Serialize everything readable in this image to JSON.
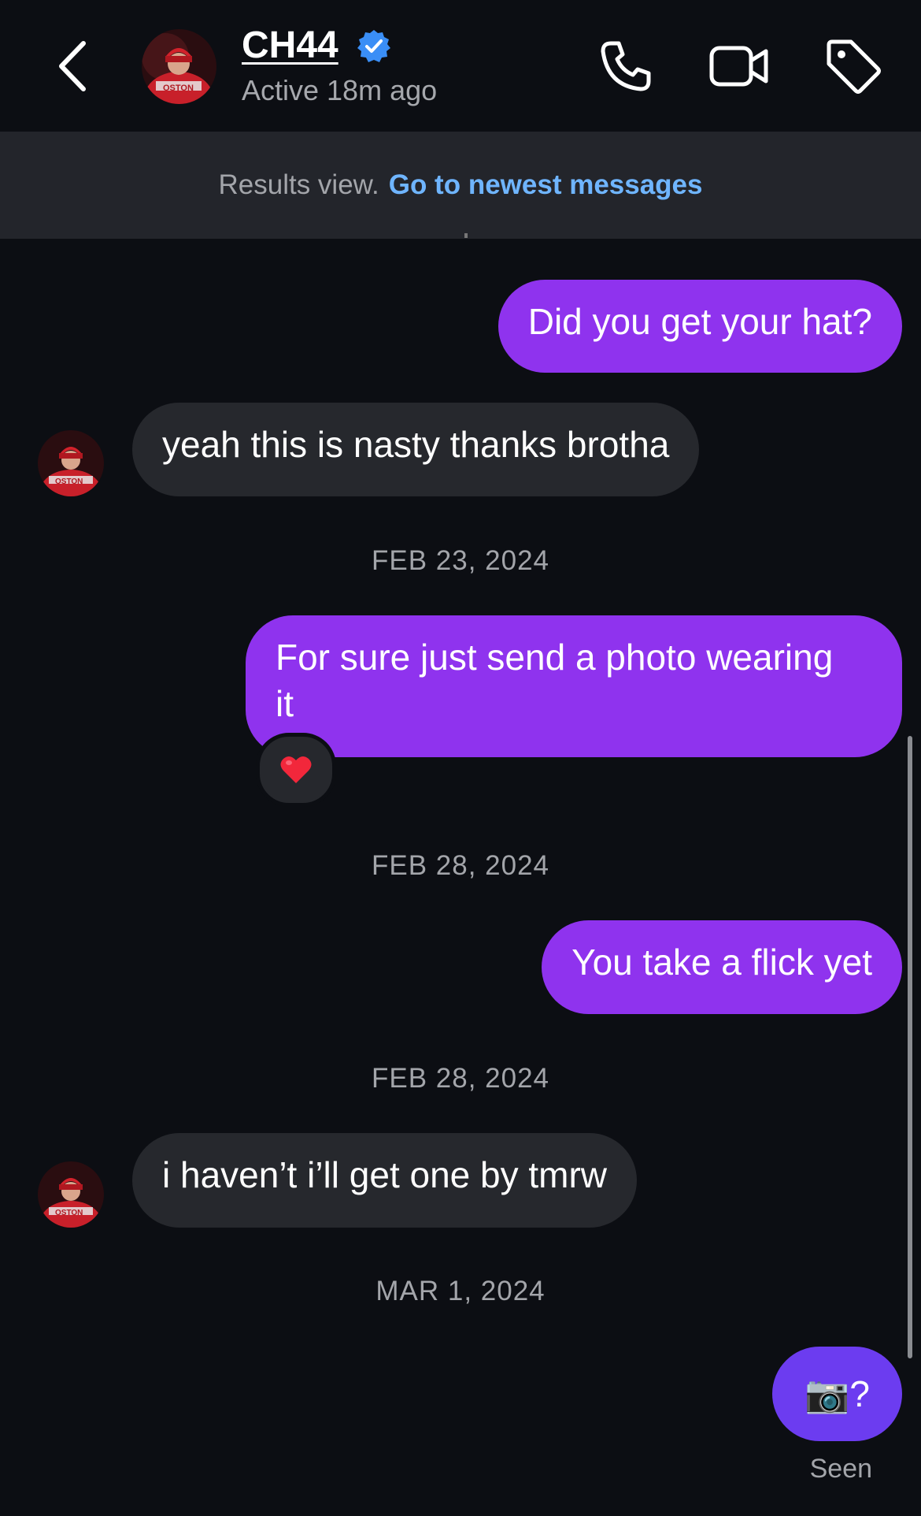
{
  "header": {
    "back_icon": "chevron-left-icon",
    "contact_name": "CH44",
    "verified_icon": "verified-badge-icon",
    "status": "Active 18m ago",
    "actions": [
      "phone-icon",
      "video-camera-icon",
      "tag-icon"
    ]
  },
  "results_bar": {
    "label": "Results view.",
    "link": "Go to newest messages"
  },
  "messages": [
    {
      "direction": "outgoing",
      "text": "Did you get your hat?"
    },
    {
      "direction": "incoming",
      "text": "yeah this is nasty thanks brotha"
    },
    {
      "type": "date",
      "text": "FEB 23, 2024"
    },
    {
      "direction": "outgoing",
      "text": "For sure just send a photo wearing it",
      "line1": "For sure just send a photo wearing",
      "line2": "it",
      "reaction": "❤️"
    },
    {
      "type": "date",
      "text": "FEB 28, 2024"
    },
    {
      "direction": "outgoing",
      "text": "You take a flick yet"
    },
    {
      "type": "date",
      "text": "FEB 28, 2024"
    },
    {
      "direction": "incoming",
      "text": "i haven’t i’ll get one by tmrw"
    },
    {
      "type": "date",
      "text": "MAR 1, 2024"
    },
    {
      "direction": "outgoing",
      "text": "📷?"
    }
  ],
  "footer": {
    "seen": "Seen"
  },
  "colors": {
    "background": "#0c0e13",
    "outgoing_bubble": "#8f33ee",
    "outgoing_bubble_last": "#6c3cf0",
    "incoming_bubble": "#26282d",
    "link": "#6fb5ff",
    "verified": "#3a8ef6"
  }
}
